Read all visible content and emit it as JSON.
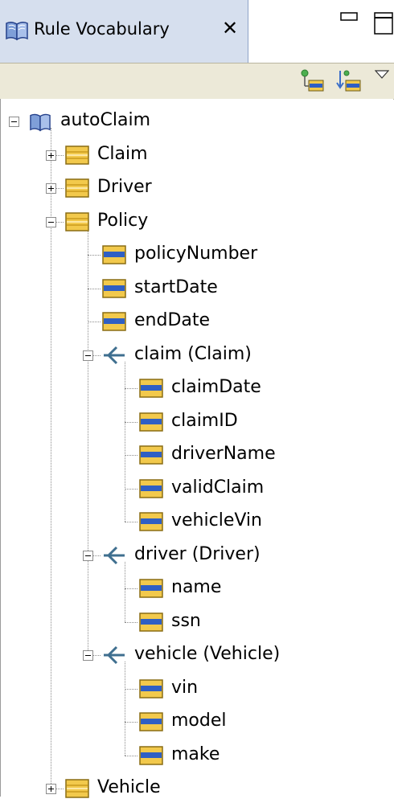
{
  "view": {
    "title": "Rule Vocabulary",
    "close_symbol": "✕",
    "minimize_icon": "minimize-icon",
    "maximize_icon": "maximize-icon"
  },
  "toolbar": {
    "buttons": [
      {
        "name": "add-term-icon"
      },
      {
        "name": "sort-terms-icon"
      }
    ],
    "menu_icon": "view-menu-triangle-icon"
  },
  "tree": {
    "root": "autoClaim",
    "nodes": [
      {
        "label": "autoClaim",
        "icon": "vocabulary-book-icon",
        "expander": "expanded"
      },
      {
        "label": "Claim",
        "icon": "entity-icon",
        "expander": "collapsed"
      },
      {
        "label": "Driver",
        "icon": "entity-icon",
        "expander": "collapsed"
      },
      {
        "label": "Policy",
        "icon": "entity-icon",
        "expander": "expanded"
      },
      {
        "label": "policyNumber",
        "icon": "attribute-icon"
      },
      {
        "label": "startDate",
        "icon": "attribute-icon"
      },
      {
        "label": "endDate",
        "icon": "attribute-icon"
      },
      {
        "label": "claim (Claim)",
        "icon": "association-icon",
        "expander": "expanded"
      },
      {
        "label": "claimDate",
        "icon": "attribute-icon"
      },
      {
        "label": "claimID",
        "icon": "attribute-icon"
      },
      {
        "label": "driverName",
        "icon": "attribute-icon"
      },
      {
        "label": "validClaim",
        "icon": "attribute-icon"
      },
      {
        "label": "vehicleVin",
        "icon": "attribute-icon"
      },
      {
        "label": "driver (Driver)",
        "icon": "association-icon",
        "expander": "expanded"
      },
      {
        "label": "name",
        "icon": "attribute-icon"
      },
      {
        "label": "ssn",
        "icon": "attribute-icon"
      },
      {
        "label": "vehicle (Vehicle)",
        "icon": "association-icon",
        "expander": "expanded"
      },
      {
        "label": "vin",
        "icon": "attribute-icon"
      },
      {
        "label": "model",
        "icon": "attribute-icon"
      },
      {
        "label": "make",
        "icon": "attribute-icon"
      },
      {
        "label": "Vehicle",
        "icon": "entity-icon",
        "expander": "collapsed"
      }
    ]
  },
  "colors": {
    "tab_active": "#d6dfee",
    "toolbar": "#ece9d8",
    "entity_icon": "#f2c94c",
    "attribute_icon_bar": "#2f5fc4",
    "association_icon": "#3f6f8f"
  }
}
